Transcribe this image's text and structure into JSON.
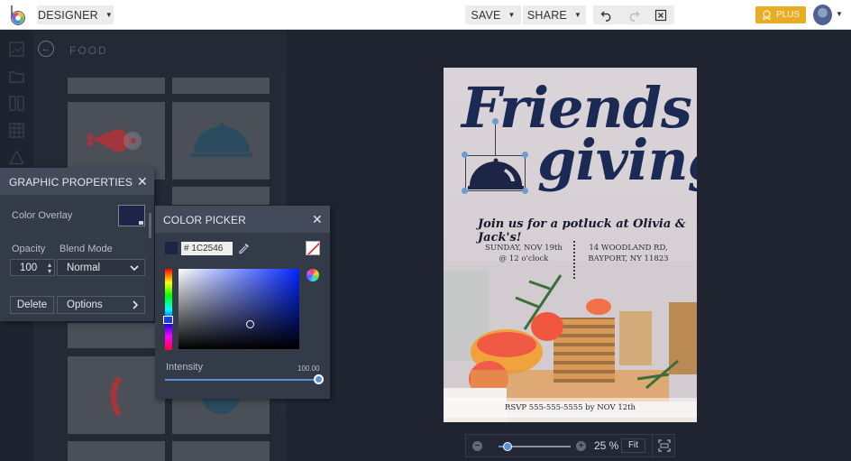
{
  "app": {
    "mode_menu": {
      "label": "DESIGNER"
    },
    "toolbar": {
      "save_label": "SAVE",
      "share_label": "SHARE",
      "undo_icon": "undo-icon",
      "redo_icon": "redo-icon",
      "close_icon": "close-project-icon",
      "plus_label": "PLUS"
    }
  },
  "library": {
    "category_title": "FOOD",
    "rail_icons": [
      "image-icon",
      "folder-icon",
      "layout-icon",
      "grid-icon",
      "shapes-icon"
    ],
    "tiles": [
      {
        "name": "ham-leg",
        "color": "#a3353c"
      },
      {
        "name": "cloche",
        "color": "#2b4b5e"
      },
      {
        "name": "chili-pepper",
        "color": "#a3353c"
      },
      {
        "name": "bowl",
        "color": "#2b4b5e"
      }
    ]
  },
  "graphic_properties": {
    "title": "GRAPHIC PROPERTIES",
    "color_overlay_label": "Color Overlay",
    "overlay_color": "#1C2546",
    "opacity_label": "Opacity",
    "opacity_value": "100",
    "blend_mode_label": "Blend Mode",
    "blend_mode_value": "Normal",
    "delete_label": "Delete",
    "options_label": "Options"
  },
  "color_picker": {
    "title": "COLOR PICKER",
    "hex_value": "# 1C2546",
    "current_color": "#1C2546",
    "intensity_label": "Intensity",
    "intensity_value": "100.00",
    "intensity_fraction": 1.0
  },
  "design": {
    "title_line1": "Friends",
    "title_line2": "giving",
    "tagline": "Join us for a potluck at Olivia & Jack's!",
    "date_line1": "SUNDAY, NOV 19th",
    "date_line2": "@ 12 o'clock",
    "address_line1": "14 WOODLAND RD,",
    "address_line2": "BAYPORT, NY 11823",
    "rsvp": "RSVP 555-555-5555 by NOV 12th",
    "title_color": "#1B2A55"
  },
  "zoom": {
    "value_label": "25 %",
    "fraction": 0.12,
    "fit_label": "Fit"
  }
}
